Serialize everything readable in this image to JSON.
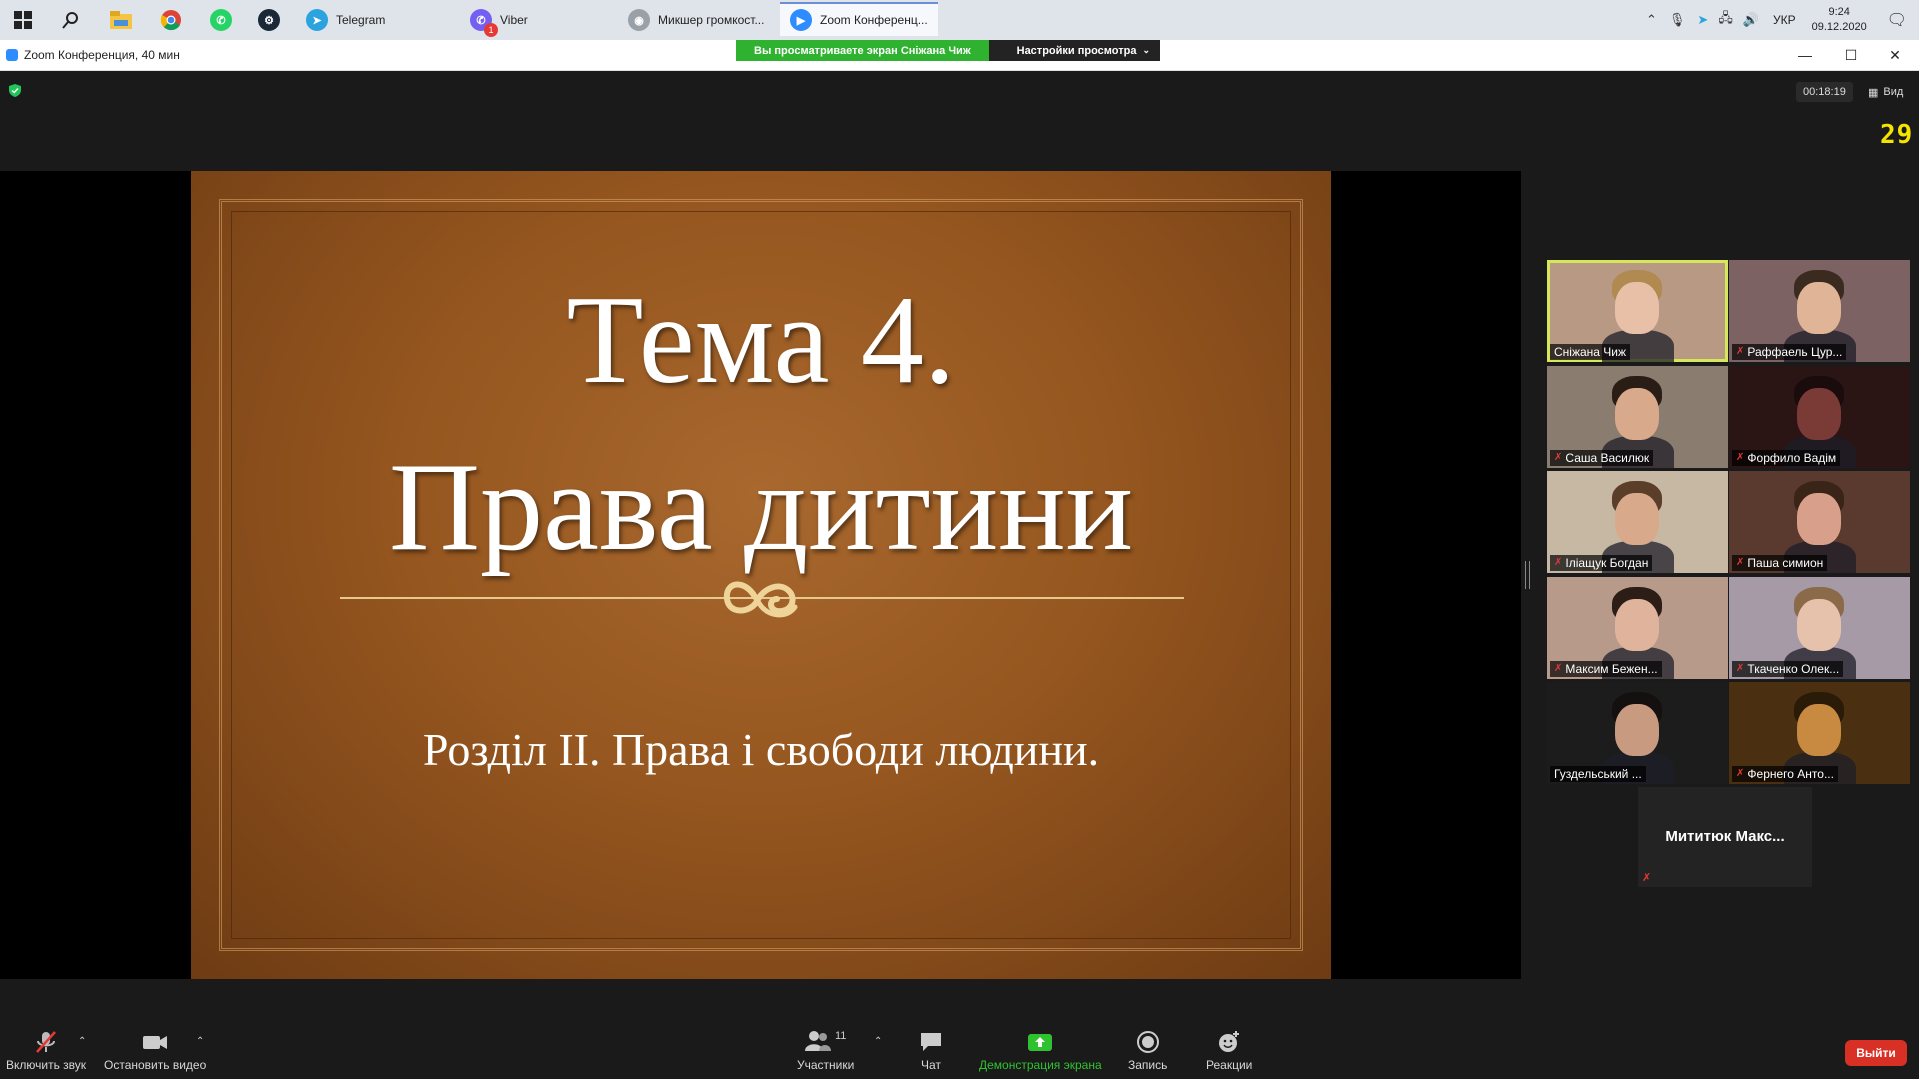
{
  "taskbar": {
    "tasks": [
      {
        "label": "Telegram"
      },
      {
        "label": "Viber",
        "badge": "1"
      },
      {
        "label": "Микшер громкост..."
      },
      {
        "label": "Zoom Конференц..."
      }
    ],
    "tray": {
      "lang": "УКР",
      "time": "9:24",
      "date": "09.12.2020"
    }
  },
  "window": {
    "title": "Zoom Конференция, 40 мин",
    "banner_viewing": "Вы просматриваете экран Сніжана Чиж",
    "banner_settings": "Настройки просмотра"
  },
  "meeting": {
    "timer": "00:18:19",
    "view_label": "Вид",
    "counter": "29"
  },
  "slide": {
    "title_line1": "Тема 4.",
    "title_line2": "Права дитини",
    "subtitle": "Розділ II. Права і свободи людини."
  },
  "participants": [
    {
      "name": "Сніжана Чиж",
      "muted": false,
      "bg": "#b89a84",
      "skin": "#e8c0a8",
      "hair": "#b08a50",
      "selected": true
    },
    {
      "name": "Раффаель Цур...",
      "muted": true,
      "bg": "#7c6262",
      "skin": "#e0b496",
      "hair": "#3a2a20"
    },
    {
      "name": "Саша Василюк",
      "muted": true,
      "bg": "#8a7c6e",
      "skin": "#d9a98c",
      "hair": "#2a1d16"
    },
    {
      "name": "Форфило Вадім",
      "muted": true,
      "bg": "#2a1414",
      "skin": "#7a3a36",
      "hair": "#1a0c0c"
    },
    {
      "name": "Іліащук Богдан",
      "muted": true,
      "bg": "#c7b8a4",
      "skin": "#d9a98c",
      "hair": "#5a3e2a"
    },
    {
      "name": "Паша симион",
      "muted": true,
      "bg": "#5a3a2e",
      "skin": "#d8a08a",
      "hair": "#3a2418"
    },
    {
      "name": "Максим Бежен...",
      "muted": true,
      "bg": "#b79a8a",
      "skin": "#e0b49c",
      "hair": "#2c1e16"
    },
    {
      "name": "Ткаченко Олек...",
      "muted": true,
      "bg": "#a69aa6",
      "skin": "#e6c2ac",
      "hair": "#8a6a48"
    },
    {
      "name": "Гуздельський ...",
      "muted": false,
      "bg": "#1c1c1c",
      "skin": "#c89a80",
      "hair": "#151010"
    },
    {
      "name": "Фернего Анто...",
      "muted": true,
      "bg": "#4a3010",
      "skin": "#c88a40",
      "hair": "#2a1a08"
    }
  ],
  "no_video_participant": {
    "name": "Мититюк  Макс..."
  },
  "toolbar": {
    "unmute": "Включить звук",
    "stop_video": "Остановить видео",
    "participants": "Участники",
    "participants_count": "11",
    "chat": "Чат",
    "share": "Демонстрация экрана",
    "record": "Запись",
    "reactions": "Реакции",
    "leave": "Выйти"
  },
  "colors": {
    "zoom_blue": "#2d8cff",
    "share_green": "#2fc22f",
    "leave_red": "#d93025",
    "active_speaker": "#d6e85a",
    "counter_yellow": "#f5e400"
  }
}
